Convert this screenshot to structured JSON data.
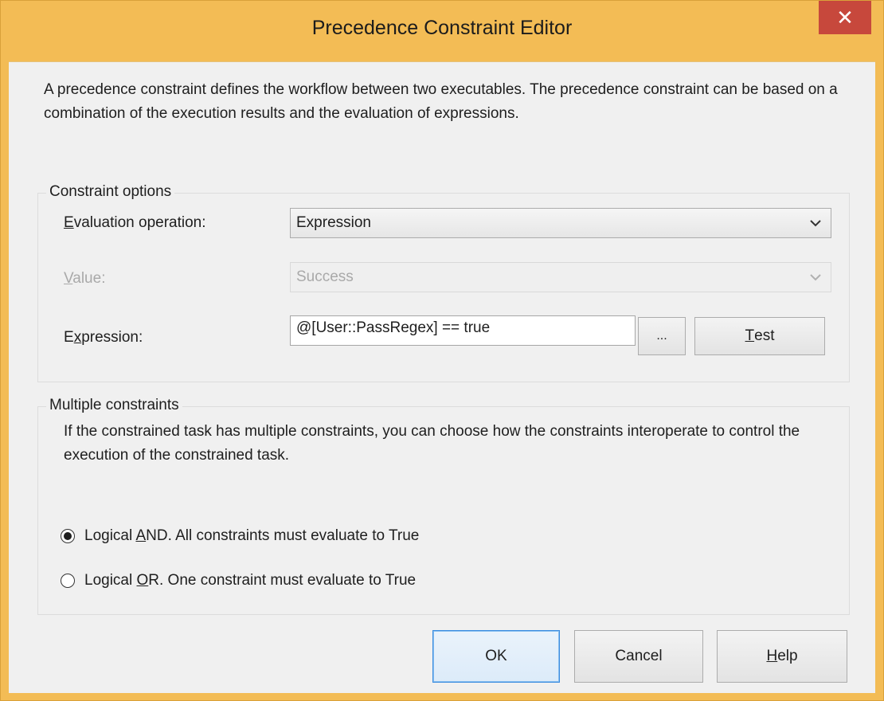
{
  "window": {
    "title": "Precedence Constraint Editor",
    "close_glyph": "✕",
    "accent_color": "#f3bc55",
    "close_color": "#c7483c"
  },
  "description": "A precedence constraint defines the workflow between two executables. The precedence constraint can be based on a combination of the execution results and the evaluation of expressions.",
  "constraint_options": {
    "legend": "Constraint options",
    "evaluation_operation": {
      "label_mnemonic": "E",
      "label_rest": "valuation operation:",
      "value": "Expression"
    },
    "value": {
      "label_mnemonic": "V",
      "label_rest": "alue:",
      "value": "Success",
      "disabled": true
    },
    "expression": {
      "label_pre": "E",
      "label_mnemonic": "x",
      "label_rest": "pression:",
      "value": "@[User::PassRegex] == true",
      "ellipsis_label": "...",
      "test_mnemonic": "T",
      "test_rest": "est"
    }
  },
  "multiple_constraints": {
    "legend": "Multiple constraints",
    "description": "If the constrained task has multiple constraints, you can choose how the constraints interoperate to control the execution of the constrained task.",
    "options": [
      {
        "pre": "Logical ",
        "mnemonic": "A",
        "rest": "ND. All constraints must evaluate to True",
        "checked": true
      },
      {
        "pre": "Logical ",
        "mnemonic": "O",
        "rest": "R. One constraint must evaluate to True",
        "checked": false
      }
    ]
  },
  "buttons": {
    "ok": "OK",
    "cancel": "Cancel",
    "help_mnemonic": "H",
    "help_rest": "elp"
  }
}
